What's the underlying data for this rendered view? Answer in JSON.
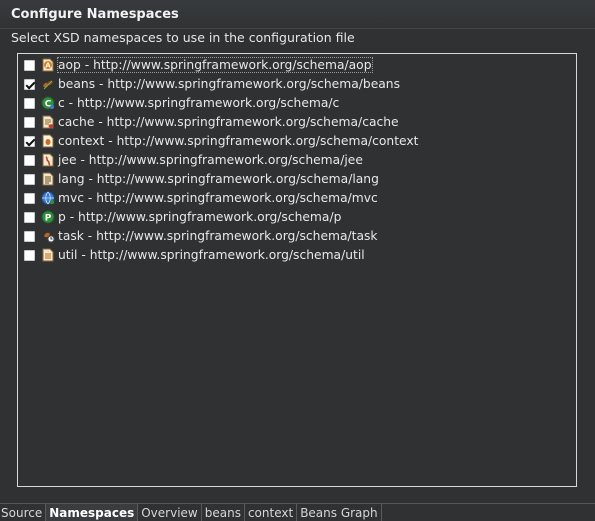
{
  "panel": {
    "title": "Configure Namespaces",
    "subtitle": "Select XSD namespaces to use in the configuration file"
  },
  "namespaces": [
    {
      "label": "aop - http://www.springframework.org/schema/aop",
      "checked": false,
      "icon": "aop-icon"
    },
    {
      "label": "beans - http://www.springframework.org/schema/beans",
      "checked": true,
      "icon": "beans-icon"
    },
    {
      "label": "c - http://www.springframework.org/schema/c",
      "checked": false,
      "icon": "c-namespace-icon"
    },
    {
      "label": "cache - http://www.springframework.org/schema/cache",
      "checked": false,
      "icon": "cache-icon"
    },
    {
      "label": "context - http://www.springframework.org/schema/context",
      "checked": true,
      "icon": "context-icon"
    },
    {
      "label": "jee - http://www.springframework.org/schema/jee",
      "checked": false,
      "icon": "jee-icon"
    },
    {
      "label": "lang - http://www.springframework.org/schema/lang",
      "checked": false,
      "icon": "lang-icon"
    },
    {
      "label": "mvc - http://www.springframework.org/schema/mvc",
      "checked": false,
      "icon": "mvc-icon"
    },
    {
      "label": "p - http://www.springframework.org/schema/p",
      "checked": false,
      "icon": "p-namespace-icon"
    },
    {
      "label": "task - http://www.springframework.org/schema/task",
      "checked": false,
      "icon": "task-icon"
    },
    {
      "label": "util - http://www.springframework.org/schema/util",
      "checked": false,
      "icon": "util-icon"
    }
  ],
  "tabs": [
    {
      "label": "Source",
      "active": false
    },
    {
      "label": "Namespaces",
      "active": true
    },
    {
      "label": "Overview",
      "active": false
    },
    {
      "label": "beans",
      "active": false
    },
    {
      "label": "context",
      "active": false
    },
    {
      "label": "Beans Graph",
      "active": false
    }
  ],
  "colors": {
    "background": "#2f3133",
    "text": "#e8e8e8",
    "list_border": "#d8d8d8",
    "checkbox": "#ffffff"
  }
}
